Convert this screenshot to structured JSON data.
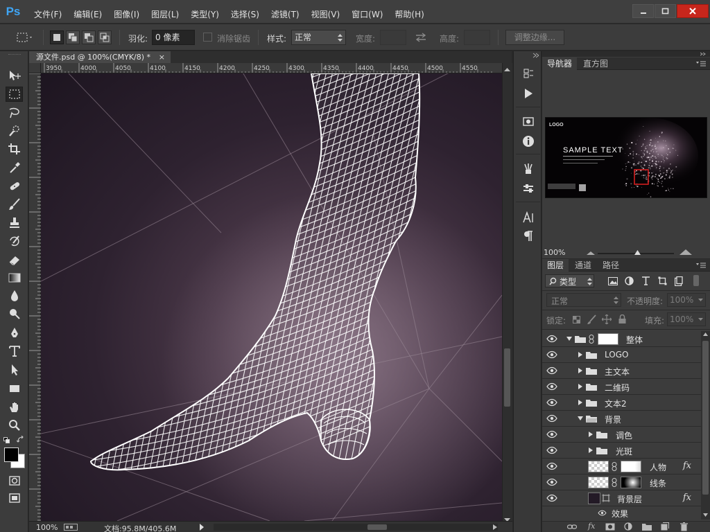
{
  "app": {
    "logo": "Ps"
  },
  "menu": [
    "文件(F)",
    "编辑(E)",
    "图像(I)",
    "图层(L)",
    "类型(Y)",
    "选择(S)",
    "滤镜(T)",
    "视图(V)",
    "窗口(W)",
    "帮助(H)"
  ],
  "window_controls": {
    "minimize": "−",
    "maximize": "□",
    "close": "✕"
  },
  "options": {
    "feather_label": "羽化:",
    "feather_value": "0 像素",
    "antialias_label": "消除锯齿",
    "style_label": "样式:",
    "style_value": "正常",
    "width_label": "宽度:",
    "height_label": "高度:",
    "refine_button": "调整边缘..."
  },
  "document": {
    "tab_title": "源文件.psd @ 100%(CMYK/8) *",
    "tab_close": "×",
    "ruler_ticks": [
      "3950",
      "4000",
      "4050",
      "4100",
      "4150",
      "4200",
      "4250",
      "4300",
      "4350",
      "4400",
      "4450",
      "4500",
      "4550"
    ],
    "zoom": "100%",
    "doc_info": "文档:95.8M/405.6M"
  },
  "navigator": {
    "tabs": [
      "导航器",
      "直方图"
    ],
    "thumb_logo": "LOGO",
    "thumb_title": "SAMPLE TEXT",
    "zoom": "100%"
  },
  "layers_panel": {
    "tabs": [
      "图层",
      "通道",
      "路径"
    ],
    "filter_kind": "类型",
    "blend_mode": "正常",
    "opacity_label": "不透明度:",
    "opacity_value": "100%",
    "lock_label": "锁定:",
    "fill_label": "填充:",
    "fill_value": "100%",
    "layers": [
      {
        "name": "整体"
      },
      {
        "name": "LOGO"
      },
      {
        "name": "主文本"
      },
      {
        "name": "二维码"
      },
      {
        "name": "文本2"
      },
      {
        "name": "背景"
      },
      {
        "name": "调色"
      },
      {
        "name": "光斑"
      },
      {
        "name": "人物",
        "fx": "fx"
      },
      {
        "name": "线条"
      },
      {
        "name": "背景层",
        "fx": "fx"
      }
    ],
    "effects_label": "效果"
  },
  "colors": {
    "accent": "#3fa5f5",
    "canvas_bg": "#2e2230",
    "mesh": "#ffffff"
  }
}
